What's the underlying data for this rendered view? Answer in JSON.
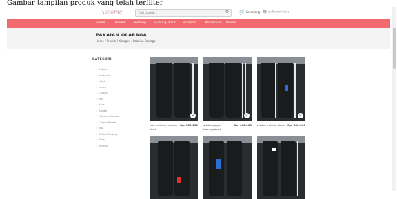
{
  "caption": "Gambar tampilan produk yang telah terfilter",
  "header": {
    "logo": "Ascome",
    "search_placeholder": "Cari produk...",
    "search_icon": "search-icon",
    "cart_label": "Keranjang",
    "user_label": "andhannd kisso"
  },
  "nav": {
    "items": [
      "Home",
      "Produk",
      "Tentang",
      "Hubungi Kami",
      "Testimoni",
      "Konfirmasi",
      "Promo"
    ]
  },
  "banner": {
    "title": "PAKAIAN OLARAGA",
    "breadcrumb": "Home / Produk / Kategori / Pakaian Olaraga"
  },
  "sidebar": {
    "heading": "KATEGORI",
    "items": [
      "Sepatu",
      "Aksesoris",
      "Jaket",
      "Jersey",
      "Celana",
      "Tas",
      "Kaos",
      "Sandal",
      "Pakaian Olaraga",
      "Celana Pendek",
      "Topi",
      "Celana Panjang",
      "Dress",
      "Kemeja"
    ]
  },
  "products": [
    {
      "name": "nike training running black",
      "price": "Rp. 380.000"
    },
    {
      "name": "adidas jogger training black",
      "price": "Rp. 440.000"
    },
    {
      "name": "adidas training black",
      "price": "Rp. 380.000"
    },
    {
      "name": "",
      "price": ""
    },
    {
      "name": "",
      "price": ""
    },
    {
      "name": "",
      "price": ""
    }
  ]
}
